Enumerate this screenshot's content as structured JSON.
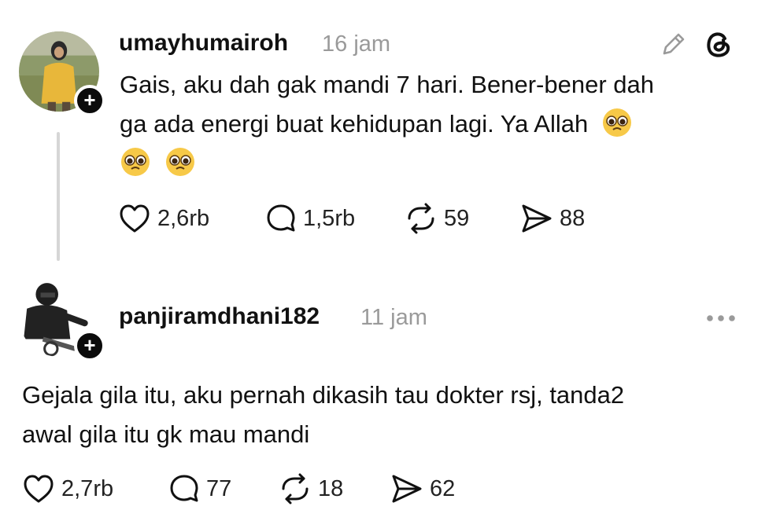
{
  "posts": [
    {
      "username": "umayhumairoh",
      "time": "16 jam",
      "text_lines": [
        "Gais, aku dah gak mandi 7 hari. Bener-bener dah",
        "ga ada energi buat kehidupan lagi. Ya Allah"
      ],
      "emoji_name": "pleading-face",
      "stats": {
        "likes": "2,6rb",
        "replies": "1,5rb",
        "reposts": "59",
        "shares": "88"
      },
      "header_icons": [
        "edit-pencil-icon",
        "threads-logo-icon"
      ]
    },
    {
      "username": "panjiramdhani182",
      "time": "11 jam",
      "text_lines": [
        "Gejala gila itu, aku pernah dikasih tau dokter rsj, tanda2",
        "awal gila itu gk mau mandi"
      ],
      "stats": {
        "likes": "2,7rb",
        "replies": "77",
        "reposts": "18",
        "shares": "62"
      },
      "header_icons": [
        "more-options-icon"
      ]
    }
  ],
  "follow_badge_label": "+",
  "colors": {
    "text": "#111111",
    "muted": "#9a9a9a",
    "line": "#d6d6d6",
    "badge": "#0b0b0b"
  }
}
